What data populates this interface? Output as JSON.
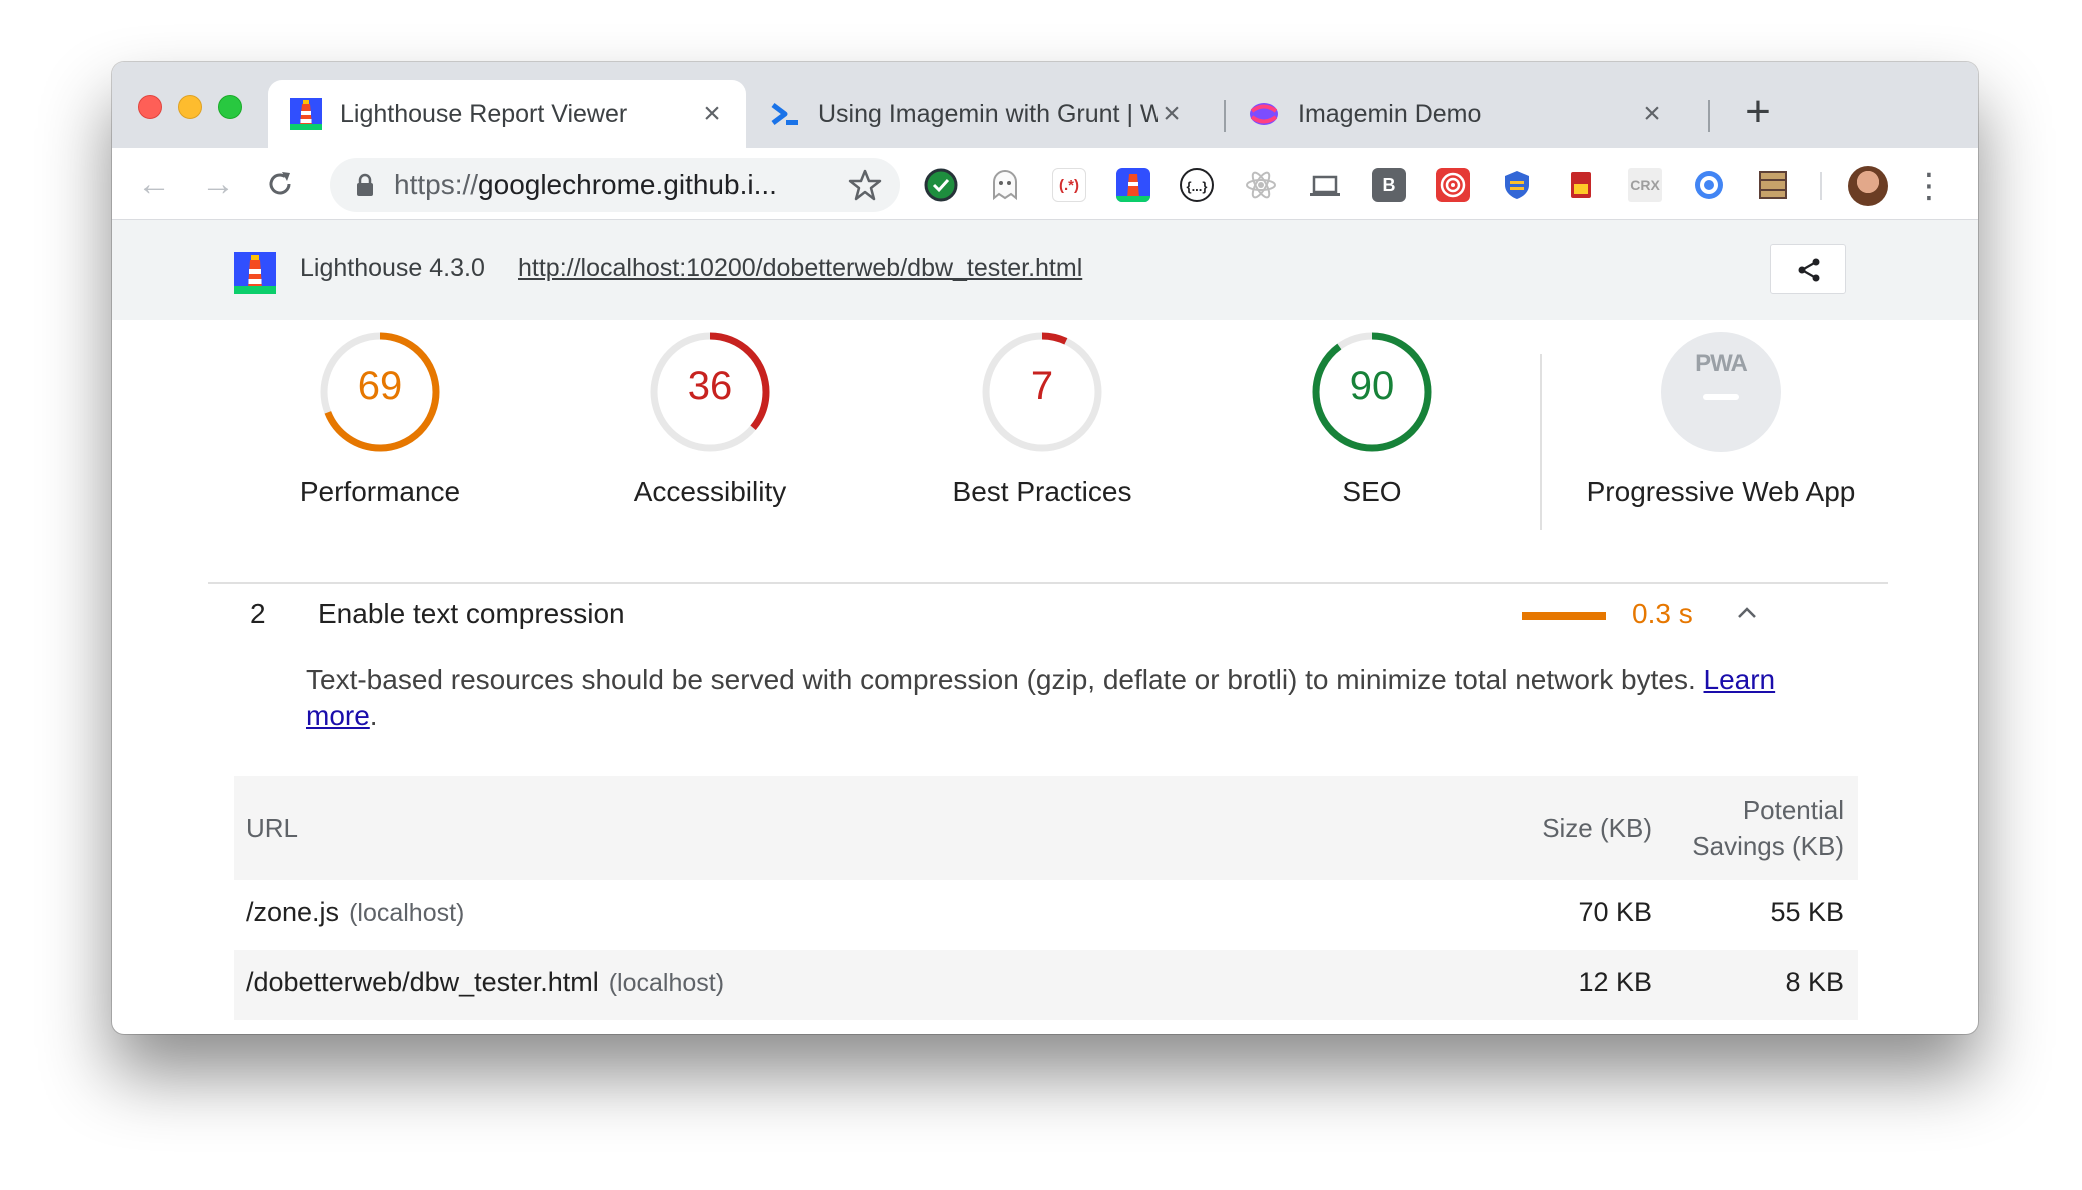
{
  "tabs": [
    {
      "title": "Lighthouse Report Viewer",
      "active": true,
      "favicon": "lighthouse-icon"
    },
    {
      "title": "Using Imagemin with Grunt  |  W",
      "active": false,
      "favicon": "web-dev-icon"
    },
    {
      "title": "Imagemin Demo",
      "active": false,
      "favicon": "imagemin-icon"
    }
  ],
  "toolbar": {
    "url": "googlechrome.github.i...",
    "url_scheme": "https://"
  },
  "extensions": [
    {
      "name": "check-icon",
      "label": "",
      "color": "#1e8e3e"
    },
    {
      "name": "ghost-icon",
      "label": "",
      "color": "#bdbdbd"
    },
    {
      "name": "regex-icon",
      "label": "(.*)",
      "color": "#ffffff"
    },
    {
      "name": "lighthouse-ext-icon",
      "label": "",
      "color": "#3367d6"
    },
    {
      "name": "code-braces-icon",
      "label": "{...}",
      "color": "#ffffff"
    },
    {
      "name": "react-icon",
      "label": "",
      "color": "#e0e0e0"
    },
    {
      "name": "laptop-icon",
      "label": "",
      "color": "#ffffff"
    },
    {
      "name": "b-icon",
      "label": "B",
      "color": "#5f6368"
    },
    {
      "name": "target-icon",
      "label": "",
      "color": "#e53935"
    },
    {
      "name": "shield-icon",
      "label": "",
      "color": "#3367d6"
    },
    {
      "name": "sd-card-icon",
      "label": "",
      "color": "#c62828"
    },
    {
      "name": "crx-icon",
      "label": "CRX",
      "color": "#ffffff"
    },
    {
      "name": "compass-icon",
      "label": "",
      "color": "#4285f4"
    },
    {
      "name": "film-icon",
      "label": "",
      "color": "#c7a26a"
    }
  ],
  "lighthouse": {
    "version": "Lighthouse 4.3.0",
    "url": "http://localhost:10200/dobetterweb/dbw_tester.html"
  },
  "gauges": [
    {
      "score": "69",
      "label": "Performance",
      "value": 69,
      "color": "#e67700"
    },
    {
      "score": "36",
      "label": "Accessibility",
      "value": 36,
      "color": "#c7221f"
    },
    {
      "score": "7",
      "label": "Best Practices",
      "value": 7,
      "color": "#c7221f"
    },
    {
      "score": "90",
      "label": "SEO",
      "value": 90,
      "color": "#178239"
    }
  ],
  "pwa": {
    "badge": "PWA",
    "label": "Progressive Web App"
  },
  "audit": {
    "number": "2",
    "title": "Enable text compression",
    "value": "0.3 s",
    "description": "Text-based resources should be served with compression (gzip, deflate or brotli) to minimize total network bytes.",
    "learn_more_1": "Learn",
    "learn_more_2": "more",
    "period": "."
  },
  "table": {
    "headers": {
      "url": "URL",
      "size": "Size (KB)",
      "savings_1": "Potential",
      "savings_2": "Savings (KB)"
    },
    "rows": [
      {
        "url": "/zone.js",
        "host": "(localhost)",
        "size": "70 KB",
        "savings": "55 KB"
      },
      {
        "url": "/dobetterweb/dbw_tester.html",
        "host": "(localhost)",
        "size": "12 KB",
        "savings": "8 KB"
      }
    ]
  },
  "colors": {
    "average": "#e67700",
    "fail": "#c7221f",
    "pass": "#178239",
    "link": "#1a0dab"
  }
}
